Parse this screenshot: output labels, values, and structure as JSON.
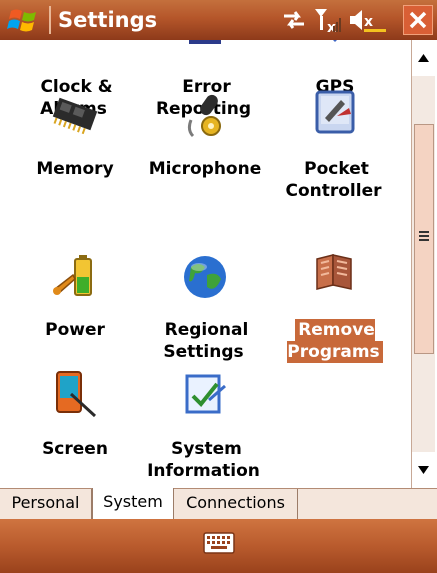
{
  "window": {
    "title": "Settings"
  },
  "titlebar_icons": [
    "windows-logo-icon",
    "connectivity-icon",
    "signal-off-icon",
    "volume-mute-icon",
    "close-icon"
  ],
  "partial_row": [
    {
      "label": "Clock & Alarms",
      "icon": "clock-icon"
    },
    {
      "label": "Error Reporting",
      "icon": "error-reporting-icon"
    },
    {
      "label": "GPS",
      "icon": "gps-icon"
    }
  ],
  "items": [
    {
      "label": "Memory",
      "icon": "memory-chip-icon"
    },
    {
      "label": "Microphone",
      "icon": "microphone-icon"
    },
    {
      "label": "Pocket Controller",
      "icon": "pocket-controller-icon"
    },
    {
      "label": "Power",
      "icon": "battery-power-icon"
    },
    {
      "label": "Regional Settings",
      "icon": "globe-icon"
    },
    {
      "label": "Remove Programs",
      "icon": "remove-programs-icon",
      "selected": true
    },
    {
      "label": "Screen",
      "icon": "screen-stylus-icon"
    },
    {
      "label": "System Information",
      "icon": "system-information-icon"
    }
  ],
  "tabs": [
    {
      "label": "Personal",
      "active": false
    },
    {
      "label": "System",
      "active": true
    },
    {
      "label": "Connections",
      "active": false
    }
  ],
  "bottombar": {
    "input": "keyboard-icon"
  },
  "colors": {
    "accent": "#b5562a",
    "selection": "#c8693a"
  }
}
